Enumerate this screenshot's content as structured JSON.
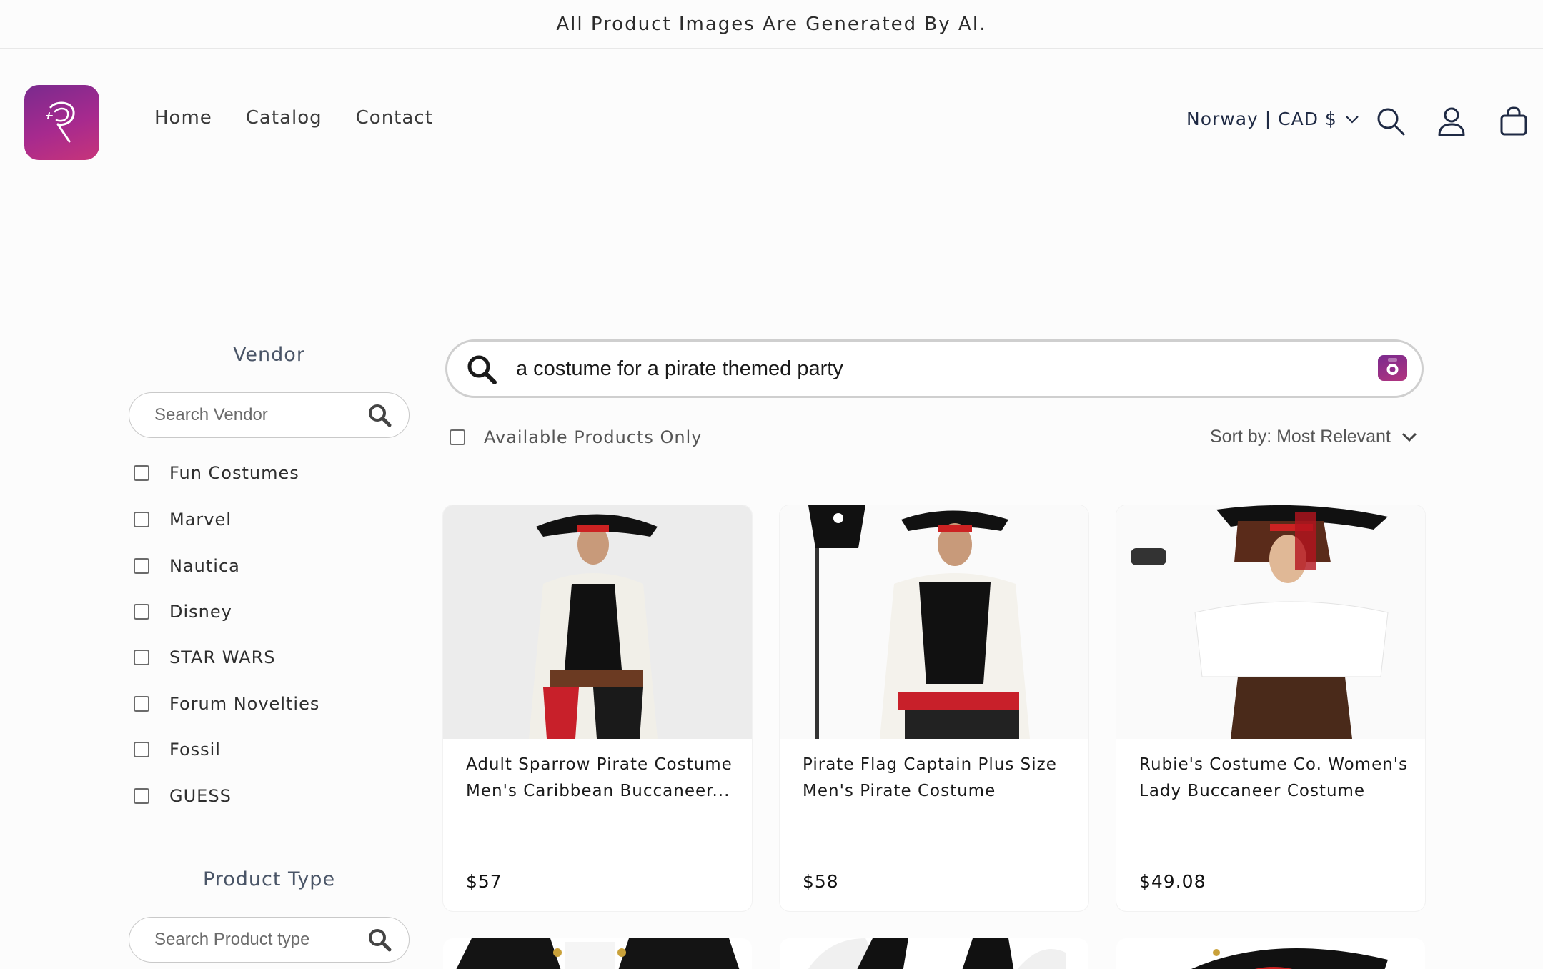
{
  "announcement": "All Product Images Are Generated By AI.",
  "header": {
    "logo_alt": "Store logo",
    "nav": [
      "Home",
      "Catalog",
      "Contact"
    ],
    "locale": "Norway | CAD $"
  },
  "search": {
    "query": "a costume for a pirate themed party"
  },
  "filters": {
    "vendor": {
      "title": "Vendor",
      "placeholder": "Search Vendor",
      "items": [
        "Fun Costumes",
        "Marvel",
        "Nautica",
        "Disney",
        "STAR WARS",
        "Forum Novelties",
        "Fossil",
        "GUESS"
      ]
    },
    "product_type": {
      "title": "Product Type",
      "placeholder": "Search Product type"
    }
  },
  "toolbar": {
    "available_only": "Available Products Only",
    "sort_label": "Sort by: Most Relevant"
  },
  "products": [
    {
      "title": "Adult Sparrow Pirate Costume Men's Caribbean Buccaneer...",
      "price": "$57"
    },
    {
      "title": "Pirate Flag Captain Plus Size Men's Pirate Costume",
      "price": "$58"
    },
    {
      "title": "Rubie's Costume Co. Women's Lady Buccaneer Costume",
      "price": "$49.08"
    }
  ],
  "colors": {
    "brand_gradient_start": "#7a2a8e",
    "brand_gradient_end": "#c7347a"
  }
}
